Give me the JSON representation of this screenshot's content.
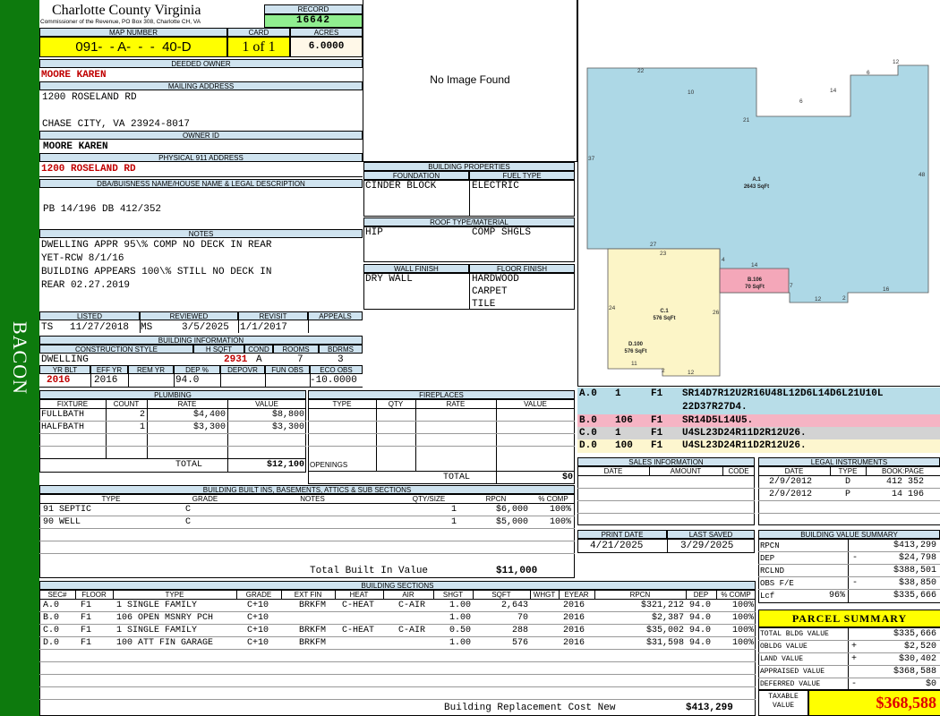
{
  "header": {
    "county": "Charlotte County Virginia",
    "commissioner": "Commissioner of the Revenue, PO Box 308, Charlotte CH, VA",
    "record_label": "RECORD",
    "record": "16642",
    "map_label": "MAP NUMBER",
    "map_number": "091-  - A-  -  -  40-D",
    "card_label": "CARD",
    "card": "1 of 1",
    "acres_label": "ACRES",
    "acres": "6.0000"
  },
  "side_tab": "BACON",
  "owner": {
    "deeded_label": "DEEDED OWNER",
    "deeded": "MOORE KAREN",
    "mailing_label": "MAILING ADDRESS",
    "mail1": "1200 ROSELAND RD",
    "mail2": "CHASE CITY, VA 23924-8017",
    "owner_id_label": "OWNER ID",
    "owner_id": "MOORE KAREN",
    "physical_label": "PHYSICAL 911 ADDRESS",
    "physical": "1200 ROSELAND RD",
    "dba_label": "DBA/BUISNESS NAME/HOUSE NAME & LEGAL DESCRIPTION",
    "legal": "PB 14/196 DB 412/352"
  },
  "notes": {
    "label": "NOTES",
    "lines": [
      "DWELLING APPR 95\\% COMP NO DECK IN REAR",
      "YET-RCW 8/1/16",
      "BUILDING APPEARS 100\\% STILL NO DECK IN",
      "REAR 02.27.2019"
    ]
  },
  "dates": {
    "listed_label": "LISTED",
    "listed_by": "TS",
    "listed": "11/27/2018",
    "reviewed_label": "REVIEWED",
    "reviewed_by": "MS",
    "reviewed": "3/5/2025",
    "revisit_label": "REVISIT",
    "revisit": "1/1/2017",
    "appeals_label": "APPEALS",
    "appeals": ""
  },
  "building_info": {
    "label": "BUILDING INFORMATION",
    "style_label": "CONSTRUCTION STYLE",
    "style": "DWELLING",
    "hsqft_label": "H SQFT",
    "hsqft": "2931",
    "cond_label": "COND",
    "cond": "A",
    "rooms_label": "ROOMS",
    "rooms": "7",
    "bdrms_label": "BDRMS",
    "bdrms": "3",
    "yrblt_label": "YR BLT",
    "yrblt": "2016",
    "effyr_label": "EFF YR",
    "effyr": "2016",
    "remyr_label": "REM YR",
    "remyr": "",
    "dep_label": "DEP %",
    "dep": "94.0",
    "depovr_label": "DEPOVR",
    "depovr": "",
    "funobs_label": "FUN OBS",
    "funobs": "",
    "ecoobs_label": "ECO OBS",
    "ecoobs": "-10.0000"
  },
  "photo": {
    "text": "No Image Found"
  },
  "building_props": {
    "label": "BUILDING PROPERTIES",
    "foundation_label": "FOUNDATION",
    "foundation": "CINDER BLOCK",
    "fuel_label": "FUEL TYPE",
    "fuel": "ELECTRIC",
    "roof_label": "ROOF TYPE/MATERIAL",
    "roof_type": "HIP",
    "roof_mat": "COMP SHGLS",
    "wall_label": "WALL FINISH",
    "wall": "DRY WALL",
    "floor_label": "FLOOR FINISH",
    "floor": [
      "HARDWOOD",
      "CARPET",
      "TILE"
    ]
  },
  "sketch": {
    "a_label": "A.1",
    "a_area": "2643 SqFt",
    "b_label": "B.106",
    "b_area": "70 SqFt",
    "c_label": "C.1",
    "c_area": "576 SqFt",
    "d_label": "D.100",
    "d_area": "576 SqFt",
    "dims": [
      "22",
      "10",
      "21",
      "6",
      "12",
      "14",
      "6",
      "37",
      "48",
      "27",
      "23",
      "4",
      "14",
      "7",
      "12",
      "2",
      "16",
      "24",
      "26",
      "11",
      "2",
      "12"
    ]
  },
  "vectors": [
    {
      "sec": "A.0",
      "n": "1",
      "fl": "F1",
      "code": "SR14D7R12U2R16U48L12D6L14D6L21U10L",
      "code2": "22D37R27D4.",
      "color": "#b8dde8"
    },
    {
      "sec": "B.0",
      "n": "106",
      "fl": "F1",
      "code": "SR14D5L14U5.",
      "color": "#f6b4c4"
    },
    {
      "sec": "C.0",
      "n": "1",
      "fl": "F1",
      "code": "U4SL23D24R11D2R12U26.",
      "color": "#d3d3d3"
    },
    {
      "sec": "D.0",
      "n": "100",
      "fl": "F1",
      "code": "U4SL23D24R11D2R12U26.",
      "color": "#fdf6cf"
    }
  ],
  "plumbing": {
    "label": "PLUMBING",
    "cols": [
      "FIXTURE",
      "COUNT",
      "RATE",
      "VALUE"
    ],
    "rows": [
      {
        "fixture": "FULLBATH",
        "count": "2",
        "rate": "$4,400",
        "value": "$8,800"
      },
      {
        "fixture": "HALFBATH",
        "count": "1",
        "rate": "$3,300",
        "value": "$3,300"
      }
    ],
    "total_label": "TOTAL",
    "total": "$12,100"
  },
  "fireplaces": {
    "label": "FIREPLACES",
    "cols": [
      "TYPE",
      "QTY",
      "RATE",
      "VALUE"
    ],
    "openings_label": "OPENINGS",
    "total_label": "TOTAL",
    "total": "$0"
  },
  "sales": {
    "label": "SALES INFORMATION",
    "cols": [
      "DATE",
      "AMOUNT",
      "CODE"
    ]
  },
  "legal_inst": {
    "label": "LEGAL INSTRUMENTS",
    "cols": [
      "DATE",
      "TYPE",
      "BOOK:PAGE"
    ],
    "rows": [
      {
        "date": "2/9/2012",
        "type": "D",
        "bp": "412 352"
      },
      {
        "date": "2/9/2012",
        "type": "P",
        "bp": "14 196"
      }
    ]
  },
  "print_info": {
    "print_label": "PRINT DATE",
    "print_date": "4/21/2025",
    "saved_label": "LAST SAVED",
    "saved_date": "3/29/2025"
  },
  "builtins": {
    "label": "BUILDING BUILT INS, BASEMENTS, ATTICS & SUB SECTIONS",
    "cols": [
      "TYPE",
      "GRADE",
      "NOTES",
      "QTY/SIZE",
      "RPCN",
      "% COMP"
    ],
    "rows": [
      {
        "type": "91 SEPTIC",
        "grade": "C",
        "notes": "",
        "qty": "1",
        "rpcn": "$6,000",
        "comp": "100%"
      },
      {
        "type": "90 WELL",
        "grade": "C",
        "notes": "",
        "qty": "1",
        "rpcn": "$5,000",
        "comp": "100%"
      }
    ],
    "total_label": "Total Built In Value",
    "total": "$11,000"
  },
  "value_summary": {
    "label": "BUILDING VALUE SUMMARY",
    "rows": [
      {
        "k": "RPCN",
        "sign": "",
        "pct": "",
        "v": "$413,299"
      },
      {
        "k": "DEP",
        "sign": "-",
        "pct": "",
        "v": "$24,798"
      },
      {
        "k": "RCLND",
        "sign": "",
        "pct": "",
        "v": "$388,501"
      },
      {
        "k": "OBS F/E",
        "sign": "-",
        "pct": "",
        "v": "$38,850"
      },
      {
        "k": "Lcf",
        "sign": "",
        "pct": "96%",
        "v": "$335,666"
      }
    ]
  },
  "building_sections": {
    "label": "BUILDING SECTIONS",
    "cols": [
      "SEC#",
      "FLOOR",
      "TYPE",
      "GRADE",
      "EXT FIN",
      "HEAT",
      "AIR",
      "SHGT",
      "SQFT",
      "WHGT",
      "EYEAR",
      "RPCN",
      "DEP",
      "% COMP"
    ],
    "rows": [
      {
        "sec": "A.0",
        "floor": "F1",
        "type": "1 SINGLE FAMILY",
        "grade": "C+10",
        "ext": "BRKFM",
        "heat": "C-HEAT",
        "air": "C-AIR",
        "shgt": "1.00",
        "sqft": "2,643",
        "whgt": "",
        "eyear": "2016",
        "rpcn": "$321,212",
        "dep": "94.0",
        "comp": "100%"
      },
      {
        "sec": "B.0",
        "floor": "F1",
        "type": "106 OPEN MSNRY PCH",
        "grade": "C+10",
        "ext": "",
        "heat": "",
        "air": "",
        "shgt": "1.00",
        "sqft": "70",
        "whgt": "",
        "eyear": "2016",
        "rpcn": "$2,387",
        "dep": "94.0",
        "comp": "100%"
      },
      {
        "sec": "C.0",
        "floor": "F1",
        "type": "1 SINGLE FAMILY",
        "grade": "C+10",
        "ext": "BRKFM",
        "heat": "C-HEAT",
        "air": "C-AIR",
        "shgt": "0.50",
        "sqft": "288",
        "whgt": "",
        "eyear": "2016",
        "rpcn": "$35,002",
        "dep": "94.0",
        "comp": "100%"
      },
      {
        "sec": "D.0",
        "floor": "F1",
        "type": "100 ATT FIN GARAGE",
        "grade": "C+10",
        "ext": "BRKFM",
        "heat": "",
        "air": "",
        "shgt": "1.00",
        "sqft": "576",
        "whgt": "",
        "eyear": "2016",
        "rpcn": "$31,598",
        "dep": "94.0",
        "comp": "100%"
      }
    ],
    "total_label": "Building Replacement Cost New",
    "total": "$413,299"
  },
  "parcel_summary": {
    "label": "PARCEL SUMMARY",
    "rows": [
      {
        "k": "TOTAL BLDG VALUE",
        "sign": "",
        "v": "$335,666"
      },
      {
        "k": "OBLDG VALUE",
        "sign": "+",
        "v": "$2,520"
      },
      {
        "k": "LAND VALUE",
        "sign": "+",
        "v": "$30,402"
      },
      {
        "k": "APPRAISED VALUE",
        "sign": "",
        "v": "$368,588"
      },
      {
        "k": "DEFERRED VALUE",
        "sign": "-",
        "v": "$0"
      }
    ],
    "taxable_label1": "TAXABLE",
    "taxable_label2": "VALUE",
    "taxable": "$368,588"
  },
  "colors": {
    "band": "#0d7a0d",
    "label_bg": "#cfe3ef",
    "yellow": "#ffff00",
    "record_bg": "#90ee90",
    "red": "#c00000",
    "sketch_a": "#add8e6",
    "sketch_b": "#f4a7b9",
    "sketch_c": "#fcf5c7"
  }
}
